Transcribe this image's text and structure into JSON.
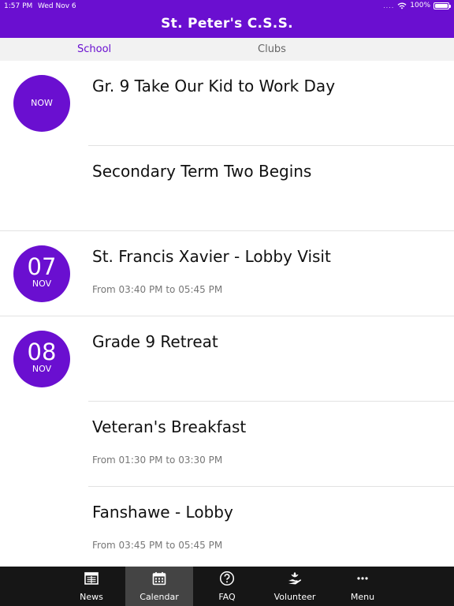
{
  "status_bar": {
    "time": "1:57 PM",
    "date": "Wed Nov 6",
    "signal": "....",
    "battery": "100%",
    "battery_level": 1.0
  },
  "header": {
    "title": "St. Peter's C.S.S."
  },
  "tabs": [
    {
      "label": "School",
      "active": true
    },
    {
      "label": "Clubs",
      "active": false
    }
  ],
  "events": [
    {
      "badge": {
        "text": "NOW"
      },
      "title": "Gr. 9 Take Our Kid to Work Day",
      "time": ""
    },
    {
      "badge": null,
      "title": "Secondary Term Two Begins",
      "time": ""
    },
    {
      "badge": {
        "day": "07",
        "month": "NOV"
      },
      "title": "St. Francis Xavier - Lobby Visit",
      "time": "From 03:40 PM to 05:45 PM"
    },
    {
      "badge": {
        "day": "08",
        "month": "NOV"
      },
      "title": "Grade 9 Retreat",
      "time": ""
    },
    {
      "badge": null,
      "title": "Veteran's Breakfast",
      "time": "From 01:30 PM to 03:30 PM"
    },
    {
      "badge": null,
      "title": "Fanshawe  - Lobby",
      "time": "From 03:45 PM to 05:45 PM"
    }
  ],
  "tabbar": [
    {
      "label": "News",
      "icon": "news-icon",
      "selected": false
    },
    {
      "label": "Calendar",
      "icon": "calendar-icon",
      "selected": true
    },
    {
      "label": "FAQ",
      "icon": "help-icon",
      "selected": false
    },
    {
      "label": "Volunteer",
      "icon": "volunteer-icon",
      "selected": false
    },
    {
      "label": "Menu",
      "icon": "more-icon",
      "selected": false
    }
  ],
  "colors": {
    "brand": "#6a0fd0",
    "tabbar_bg": "#161616",
    "tabbar_selected": "#444444"
  }
}
